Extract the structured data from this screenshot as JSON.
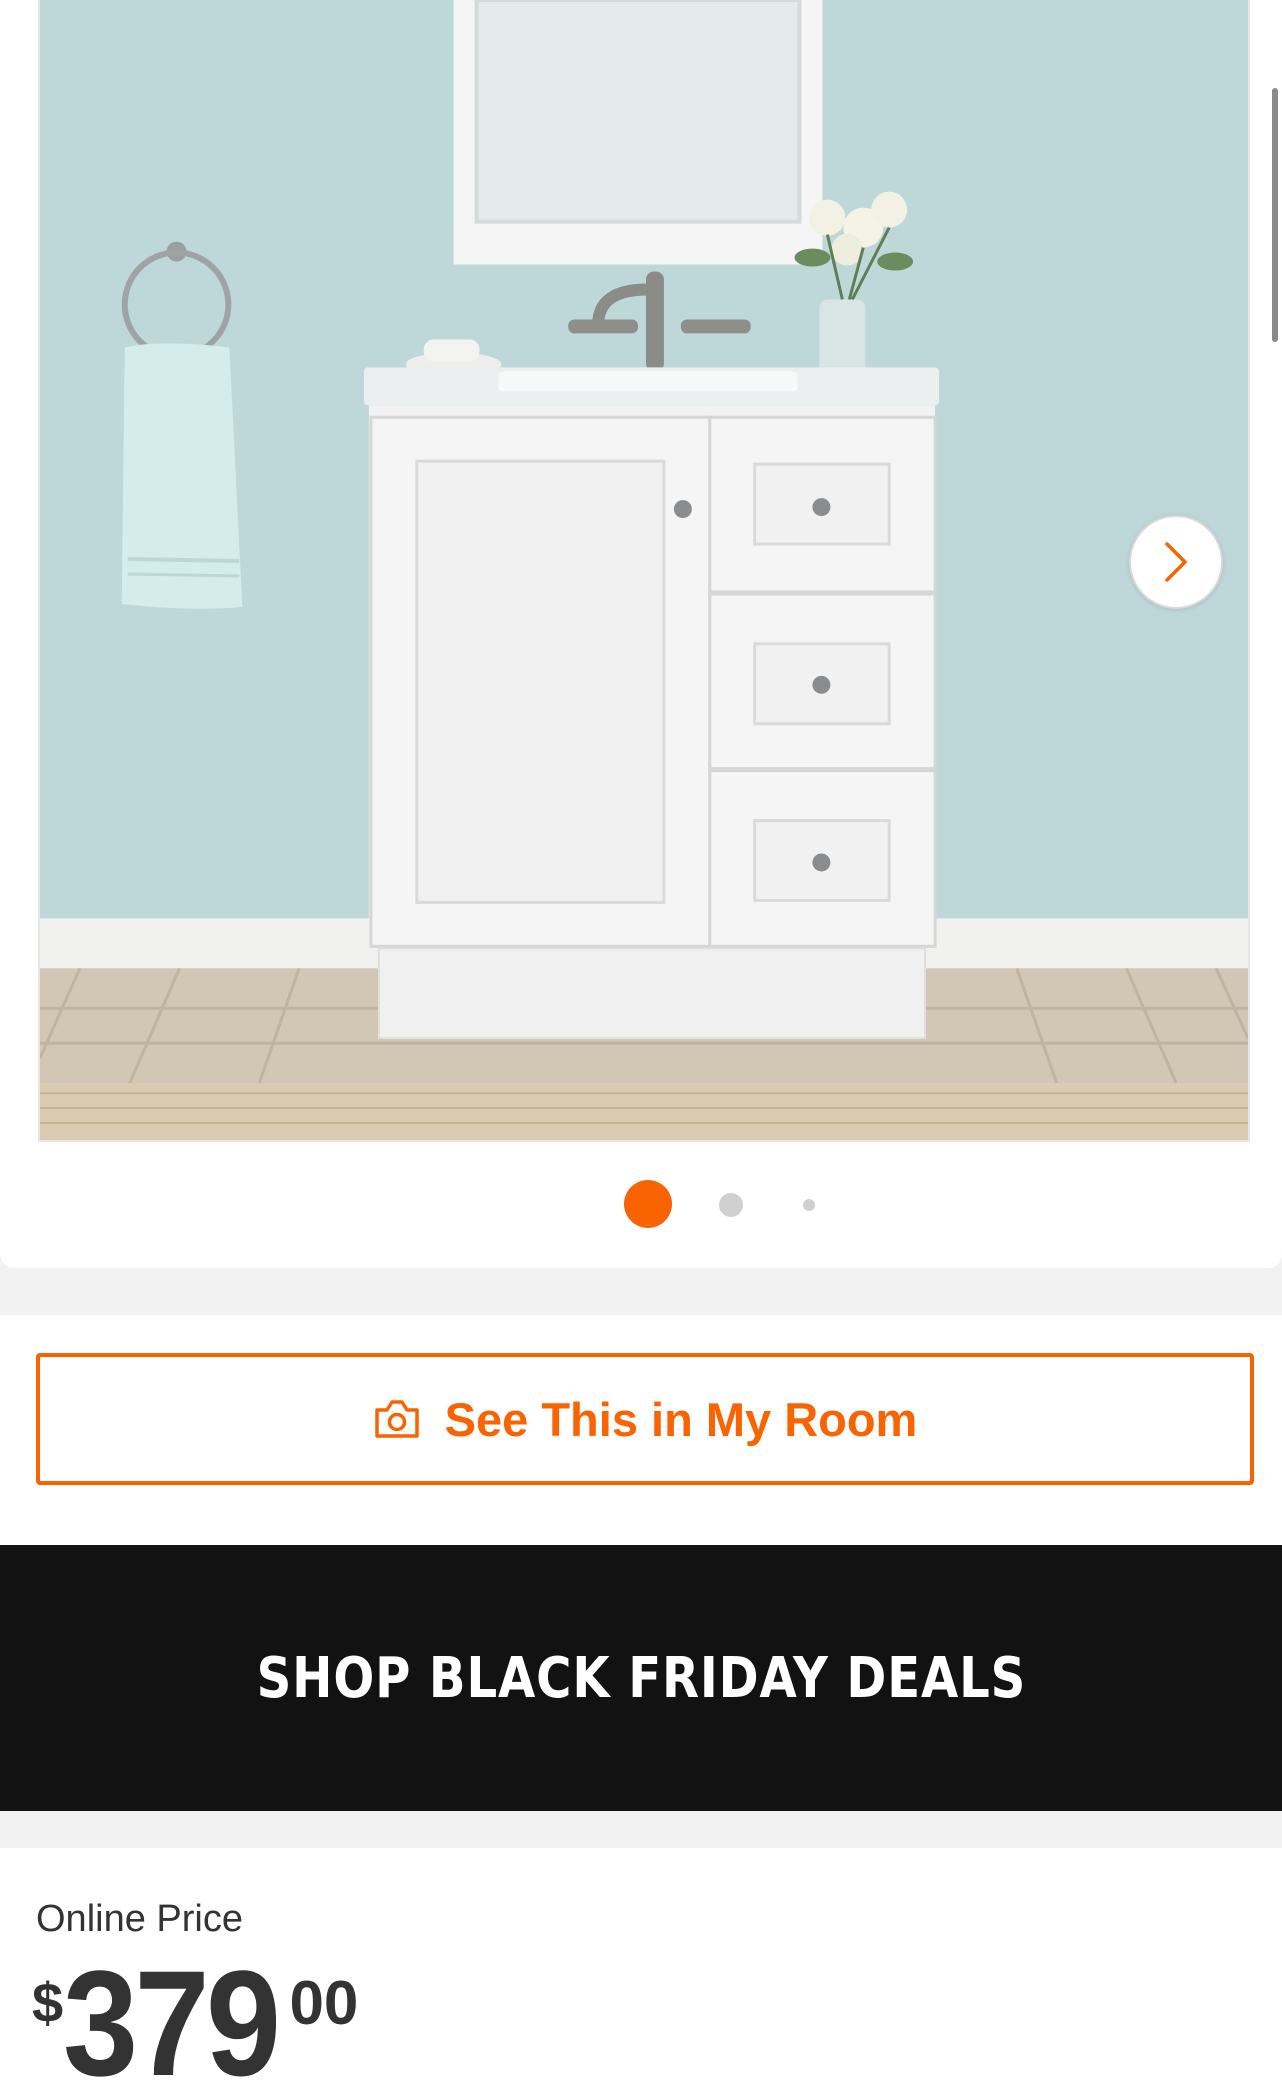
{
  "gallery": {
    "image_alt": "White bathroom vanity with cabinet door and three drawers",
    "next_icon": "chevron-right-icon",
    "dots_count": 3,
    "active_dot": 1
  },
  "ar_button": {
    "icon": "camera-icon",
    "label": "See This in My Room"
  },
  "promo": {
    "label": "SHOP BLACK FRIDAY DEALS"
  },
  "price": {
    "label": "Online Price",
    "currency": "$",
    "dollars": "379",
    "cents": "00"
  },
  "colors": {
    "accent": "#f96302",
    "banner_bg": "#121212",
    "text": "#333333"
  }
}
